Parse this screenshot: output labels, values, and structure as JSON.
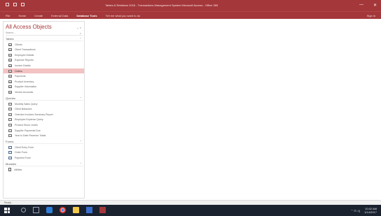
{
  "window": {
    "title": "Tables & Relations 2016 - Transactions Management System Microsoft Access - Office 365",
    "min": "—",
    "close": "✕",
    "accent_color": "#a4373a"
  },
  "ribbon": {
    "tabs": [
      "File",
      "Home",
      "Create",
      "External Data",
      "Database Tools",
      "Tell me what you want to do"
    ],
    "active_tab": "Database Tools",
    "user": "Sign in"
  },
  "nav": {
    "title": "All Access Objects",
    "title_controls": "⌄ «",
    "search_placeholder": "Search...",
    "groups": [
      {
        "label": "Tables",
        "items": [
          {
            "label": "Clients",
            "icon": "table-icon"
          },
          {
            "label": "Client Transactions",
            "icon": "table-icon"
          },
          {
            "label": "Employee Details",
            "icon": "table-icon"
          },
          {
            "label": "Expense Reports",
            "icon": "table-icon"
          },
          {
            "label": "Invoice Details",
            "icon": "table-icon"
          },
          {
            "label": "Orders",
            "icon": "table-icon",
            "selected": true
          },
          {
            "label": "Payments",
            "icon": "table-icon"
          },
          {
            "label": "Product Inventory",
            "icon": "table-icon"
          },
          {
            "label": "Supplier Information",
            "icon": "table-icon"
          },
          {
            "label": "Vendor Accounts",
            "icon": "table-icon"
          }
        ]
      },
      {
        "label": "Queries",
        "items": [
          {
            "label": "Monthly Sales Query",
            "icon": "query-icon"
          },
          {
            "label": "Client Balances",
            "icon": "query-icon"
          },
          {
            "label": "Overdue Invoices Summary Report",
            "icon": "query-icon"
          },
          {
            "label": "Employee Expense Query",
            "icon": "query-icon"
          },
          {
            "label": "Product Stock Levels",
            "icon": "query-icon"
          },
          {
            "label": "Supplier Payments Due",
            "icon": "query-icon"
          },
          {
            "label": "Year to Date Revenue Totals",
            "icon": "query-icon"
          }
        ]
      },
      {
        "label": "Forms",
        "items": [
          {
            "label": "Client Entry Form",
            "icon": "form-icon"
          },
          {
            "label": "Order Form",
            "icon": "form-icon"
          },
          {
            "label": "Payment Form",
            "icon": "form-icon"
          }
        ]
      },
      {
        "label": "Modules",
        "items": [
          {
            "label": "Utilities",
            "icon": "module-icon"
          }
        ]
      }
    ]
  },
  "status": {
    "text": "Ready"
  },
  "taskbar": {
    "time": "10:42 AM",
    "date": "1/14/2017",
    "tray": "⌃ ⊡ ◁)"
  }
}
